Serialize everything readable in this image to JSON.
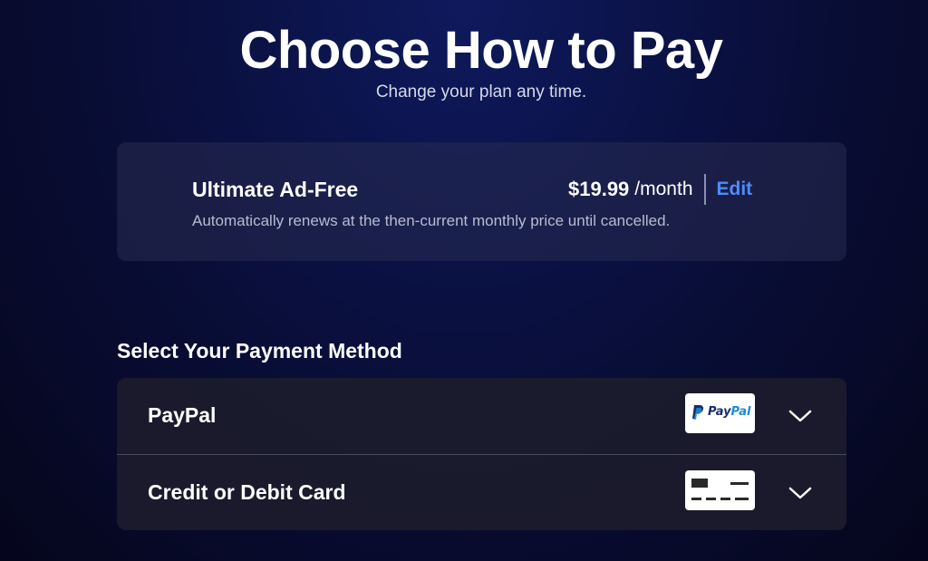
{
  "header": {
    "title": "Choose How to Pay",
    "subtitle": "Change your plan any time."
  },
  "plan": {
    "name": "Ultimate Ad-Free",
    "price": "$19.99",
    "period": "/month",
    "edit_label": "Edit",
    "note": "Automatically renews at the then-current monthly price until cancelled."
  },
  "payment": {
    "heading": "Select Your Payment Method",
    "methods": [
      {
        "label": "PayPal",
        "logo_icon": "paypal-logo",
        "logo_text_a": "Pay",
        "logo_text_b": "Pal"
      },
      {
        "label": "Credit or Debit Card",
        "logo_icon": "credit-card-icon"
      }
    ]
  },
  "colors": {
    "accent": "#4f8bff",
    "paypal_dark": "#1a2a6e",
    "paypal_light": "#1c8bd8"
  }
}
